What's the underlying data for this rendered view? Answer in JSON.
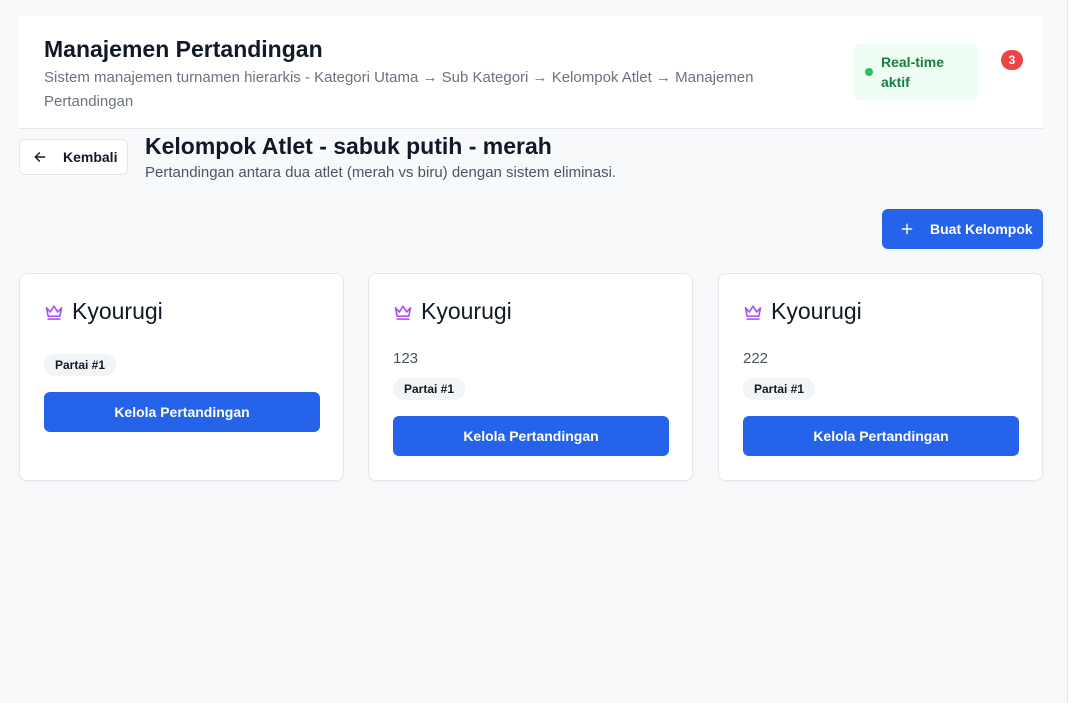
{
  "header": {
    "title": "Manajemen Pertandingan",
    "subtitle": "Sistem manajemen turnamen hierarkis - Kategori Utama → Sub Kategori → Kelompok Atlet → Manajemen Pertandingan",
    "realtime_label": "Real-time aktif",
    "notification_count": "3"
  },
  "nav": {
    "back_label": "Kembali"
  },
  "page": {
    "title": "Kelompok Atlet - sabuk putih - merah",
    "subtitle": "Pertandingan antara dua atlet (merah vs biru) dengan sistem eliminasi."
  },
  "toolbar": {
    "create_label": "Buat Kelompok"
  },
  "cards": [
    {
      "title": "Kyourugi",
      "description": "",
      "chip": "Partai #1",
      "action_label": "Kelola Pertandingan"
    },
    {
      "title": "Kyourugi",
      "description": "123",
      "chip": "Partai #1",
      "action_label": "Kelola Pertandingan"
    },
    {
      "title": "Kyourugi",
      "description": "222",
      "chip": "Partai #1",
      "action_label": "Kelola Pertandingan"
    }
  ],
  "colors": {
    "primary": "#2563eb",
    "crown_icon": "#a855f7",
    "realtime_bg": "#f0fdf4",
    "realtime_text": "#15803d",
    "notification_bg": "#ef4444"
  },
  "icons": {
    "back": "arrow-left-icon",
    "create": "plus-icon",
    "card": "crown-icon",
    "status": "status-dot-icon"
  }
}
